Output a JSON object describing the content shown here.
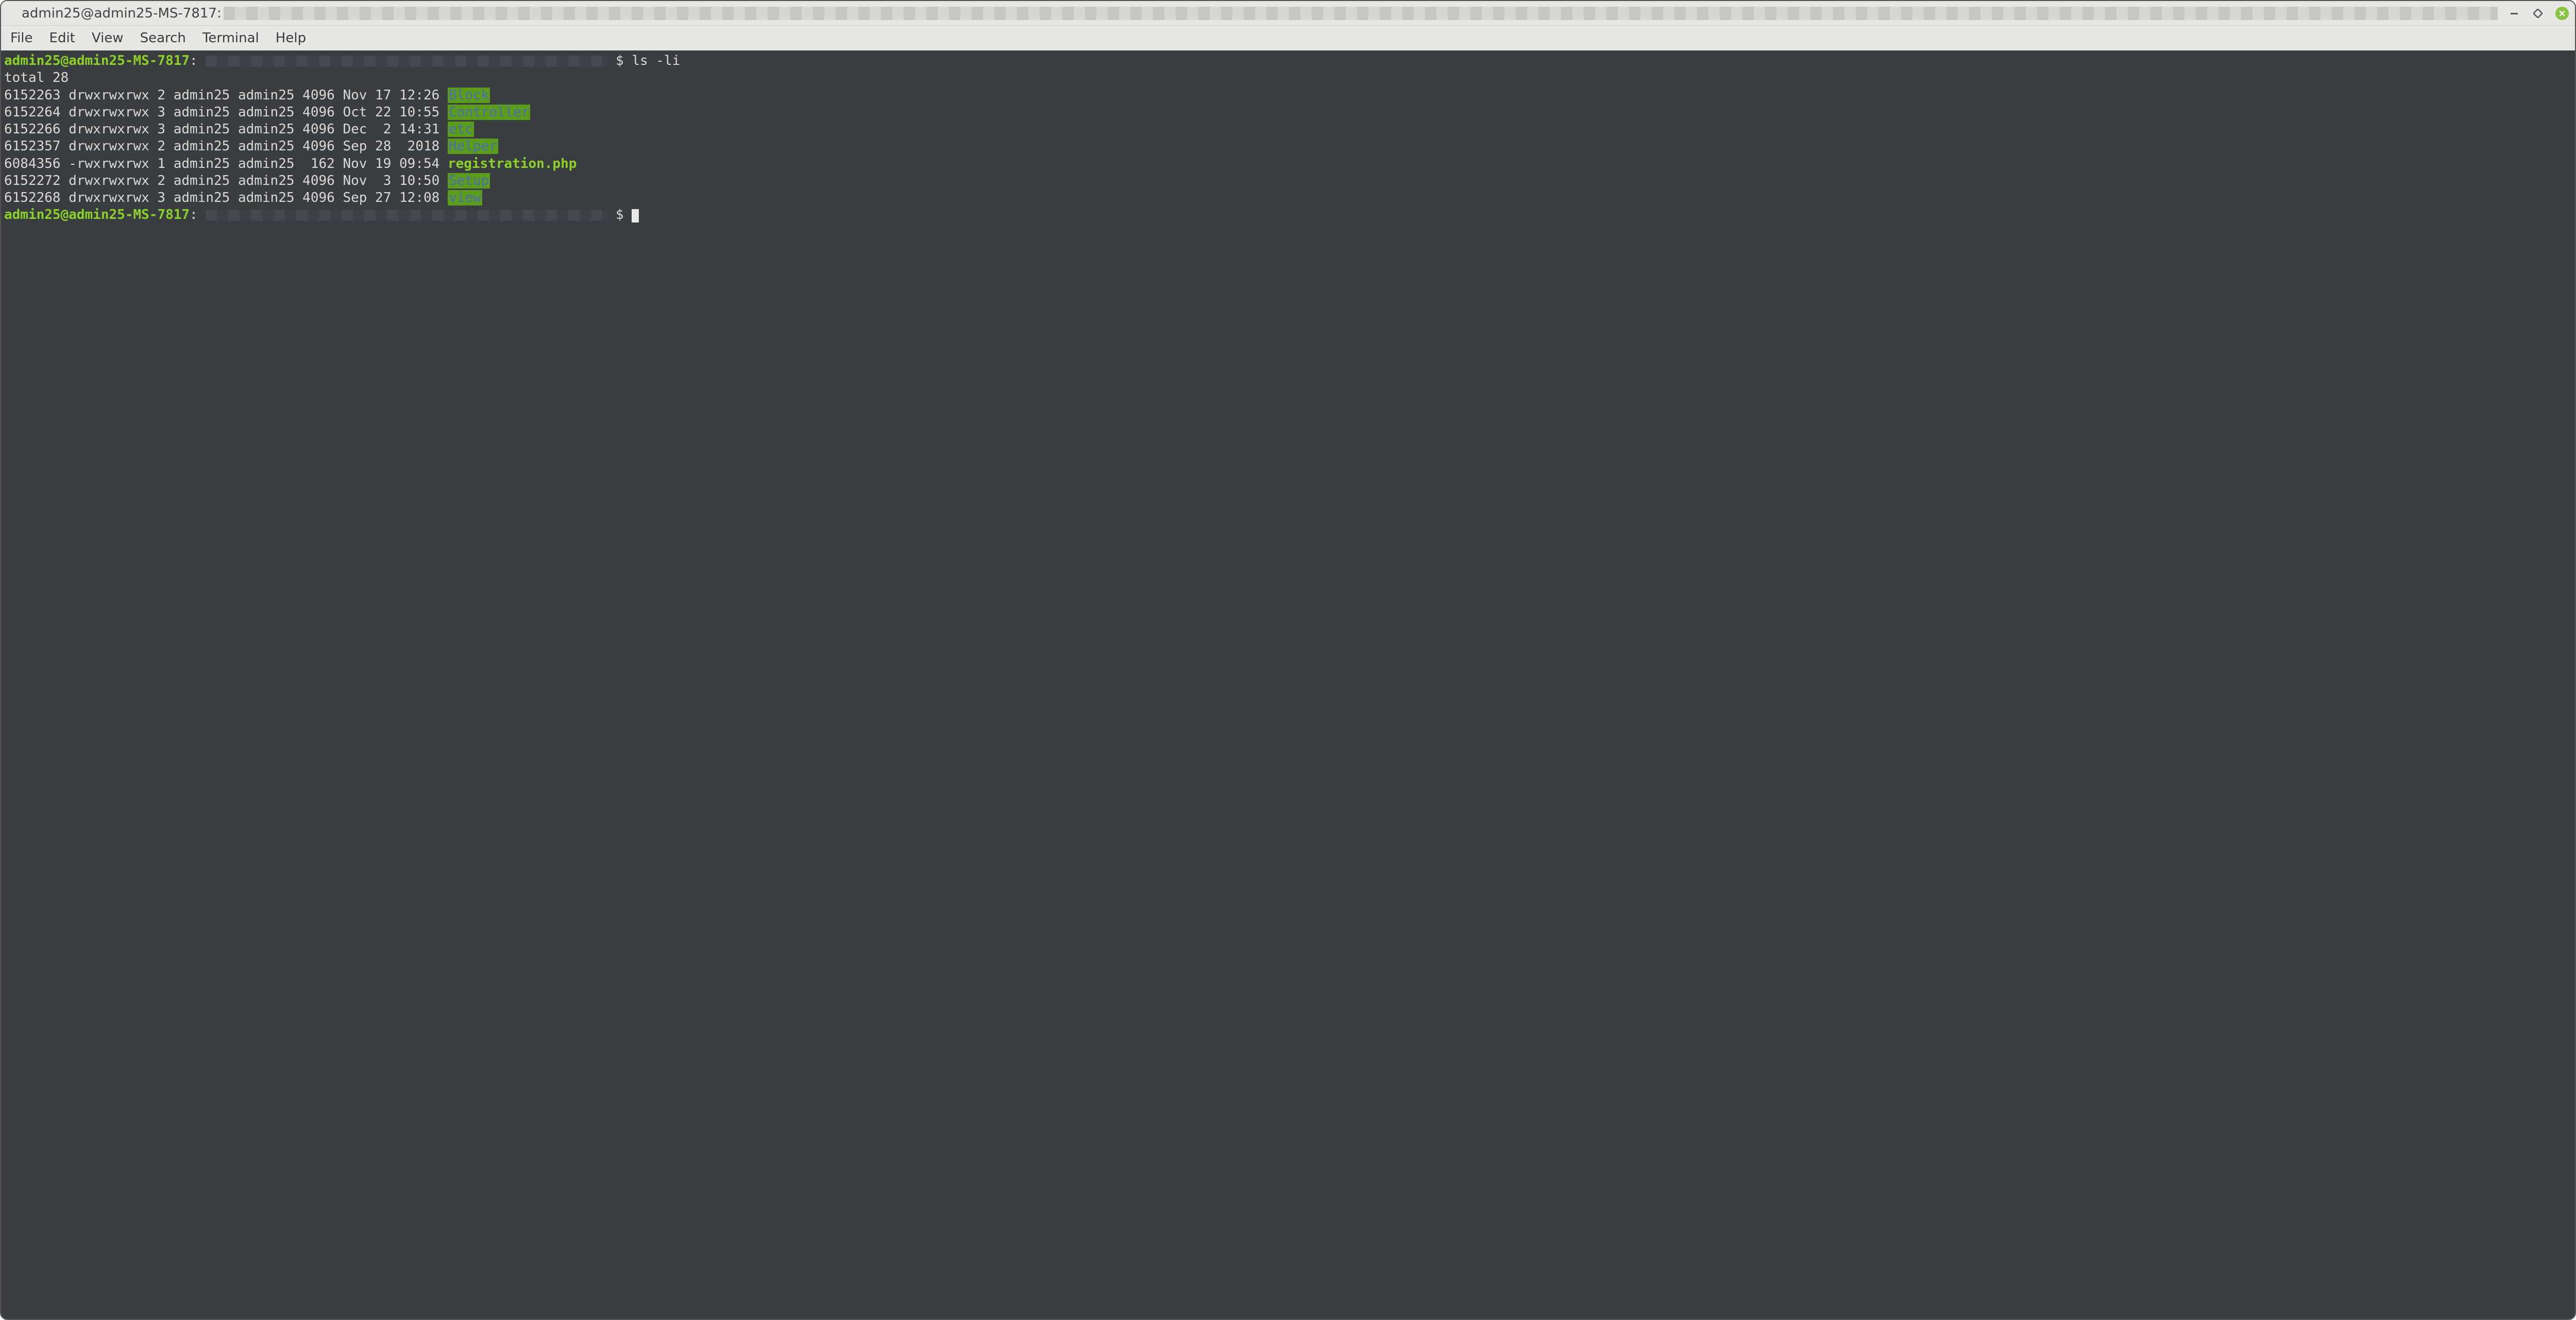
{
  "titlebar": {
    "title": "admin25@admin25-MS-7817:"
  },
  "menubar": {
    "items": [
      "File",
      "Edit",
      "View",
      "Search",
      "Terminal",
      "Help"
    ]
  },
  "terminal": {
    "prompt_user": "admin25@admin25-MS-7817",
    "prompt_sep": ":",
    "prompt_symbol": "$",
    "command": "ls -li",
    "total_line": "total 28",
    "listing": [
      {
        "inode": "6152263",
        "perm": "drwxrwxrwx",
        "links": "2",
        "owner": "admin25",
        "group": "admin25",
        "size": "4096",
        "date": "Nov 17 12:26",
        "name": "Block",
        "kind": "dir"
      },
      {
        "inode": "6152264",
        "perm": "drwxrwxrwx",
        "links": "3",
        "owner": "admin25",
        "group": "admin25",
        "size": "4096",
        "date": "Oct 22 10:55",
        "name": "Controller",
        "kind": "dir"
      },
      {
        "inode": "6152266",
        "perm": "drwxrwxrwx",
        "links": "3",
        "owner": "admin25",
        "group": "admin25",
        "size": "4096",
        "date": "Dec  2 14:31",
        "name": "etc",
        "kind": "dir"
      },
      {
        "inode": "6152357",
        "perm": "drwxrwxrwx",
        "links": "2",
        "owner": "admin25",
        "group": "admin25",
        "size": "4096",
        "date": "Sep 28  2018",
        "name": "Helper",
        "kind": "dir"
      },
      {
        "inode": "6084356",
        "perm": "-rwxrwxrwx",
        "links": "1",
        "owner": "admin25",
        "group": "admin25",
        "size": " 162",
        "date": "Nov 19 09:54",
        "name": "registration.php",
        "kind": "file"
      },
      {
        "inode": "6152272",
        "perm": "drwxrwxrwx",
        "links": "2",
        "owner": "admin25",
        "group": "admin25",
        "size": "4096",
        "date": "Nov  3 10:50",
        "name": "Setup",
        "kind": "dir"
      },
      {
        "inode": "6152268",
        "perm": "drwxrwxrwx",
        "links": "3",
        "owner": "admin25",
        "group": "admin25",
        "size": "4096",
        "date": "Sep 27 12:08",
        "name": "view",
        "kind": "dir"
      }
    ]
  }
}
